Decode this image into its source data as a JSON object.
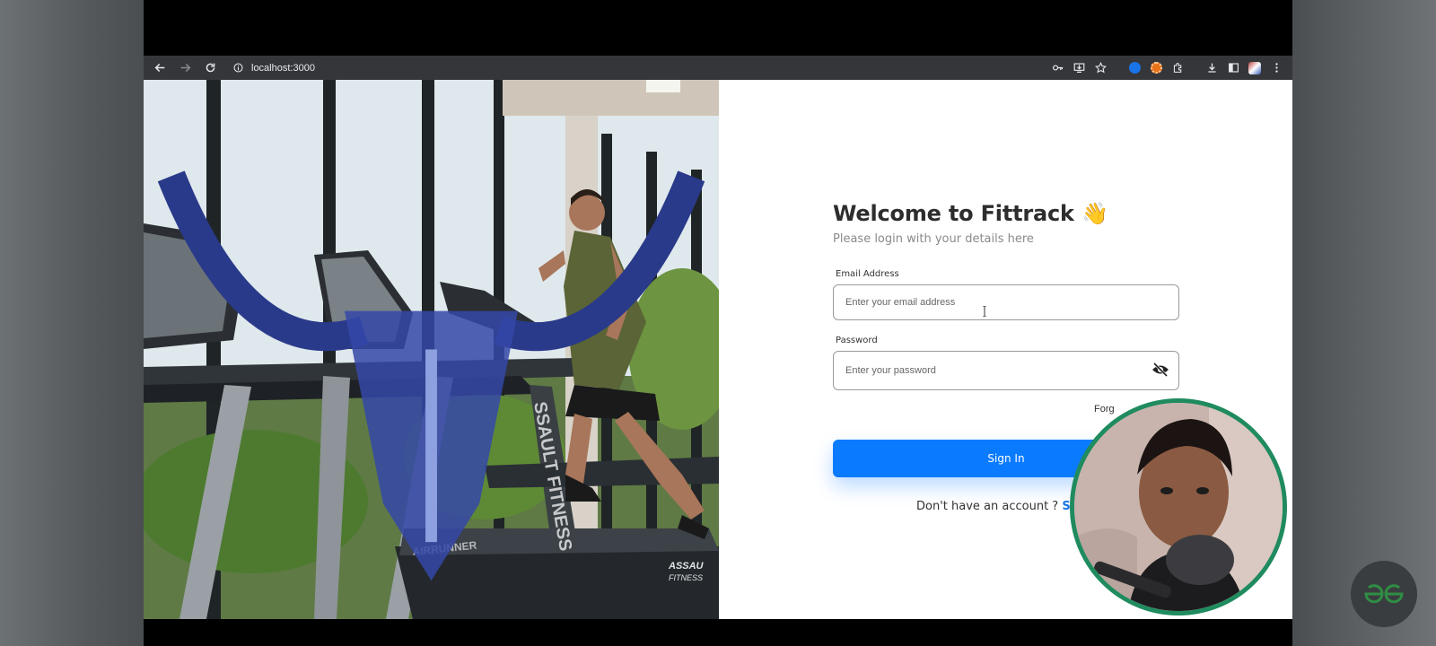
{
  "browser": {
    "url": "localhost:3000"
  },
  "login": {
    "title": "Welcome to Fittrack",
    "title_emoji": "👋",
    "subtitle": "Please login with your details here",
    "email_label": "Email Address",
    "email_placeholder": "Enter your email address",
    "password_label": "Password",
    "password_placeholder": "Enter your password",
    "forgot_text": "Forg",
    "signin_label": "Sign In",
    "signup_prompt": "Don't have an account ? ",
    "signup_link": "Sig"
  },
  "theme": {
    "accent": "#0a7bff",
    "link": "#1a73e8",
    "webcam_ring": "#1f8b5f",
    "toolbar_bg": "#35363a"
  },
  "icons": [
    "back-arrow-icon",
    "forward-arrow-icon",
    "reload-icon",
    "info-icon",
    "key-icon",
    "install-icon",
    "star-icon",
    "extension-icon",
    "download-icon",
    "side-panel-icon",
    "menu-icon",
    "eye-off-icon",
    "geeksforgeeks-logo-icon"
  ]
}
